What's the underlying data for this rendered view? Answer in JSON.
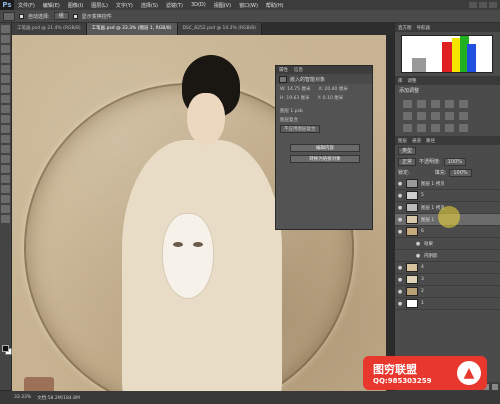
{
  "app": {
    "logo": "Ps"
  },
  "menubar": {
    "items": [
      "文件(F)",
      "编辑(E)",
      "图像(I)",
      "图层(L)",
      "文字(Y)",
      "选择(S)",
      "滤镜(T)",
      "3D(D)",
      "视图(V)",
      "窗口(W)",
      "帮助(H)"
    ]
  },
  "options": {
    "auto_select_label": "自动选择:",
    "auto_select_value": "组",
    "transform_label": "显示变换控件"
  },
  "tabs": [
    {
      "label": "工笔画.psd @ 21.4% (RGB/8)",
      "active": false
    },
    {
      "label": "工笔画.psd @ 33.3% (图层 1, RGB/8)",
      "active": true
    },
    {
      "label": "DSC_8252.psd @ 14.3% (RGB/8)",
      "active": false
    }
  ],
  "properties": {
    "tabs": [
      "属性",
      "信息"
    ],
    "type": "嵌入的智能对象",
    "w_label": "W:",
    "w_value": "14.75 厘米",
    "h_label": "H:",
    "h_value": "19.63 厘米",
    "x_label": "X:",
    "x_value": "20.40 厘米",
    "y_label": "Y:",
    "y_value": "0.10 厘米",
    "layer_name": "图层 1.psb",
    "comp_label": "图层复合",
    "comp_value": "不应用图层复合",
    "edit_btn": "编辑内容",
    "convert_btn": "转换为链接对象"
  },
  "dock": {
    "histogram_tabs": [
      "直方图",
      "导航器"
    ],
    "adjust_tabs": [
      "库",
      "调整"
    ],
    "adjust_label": "添加调整",
    "layers_tabs": [
      "图层",
      "通道",
      "路径"
    ],
    "kind": "类型",
    "blend": "正常",
    "opacity_label": "不透明度:",
    "opacity": "100%",
    "lock_label": "锁定:",
    "fill_label": "填充:",
    "fill": "100%",
    "layers": [
      {
        "name": "图层 1 拷贝",
        "thumb": "#9a9a9a",
        "selected": false
      },
      {
        "name": "5",
        "thumb": "#cfcfcf",
        "selected": false
      },
      {
        "name": "图层 1 拷贝",
        "thumb": "#bcbcbc",
        "selected": false
      },
      {
        "name": "图层 1",
        "thumb": "#d8c7a8",
        "selected": true
      },
      {
        "name": "6",
        "thumb": "#c4a97c",
        "selected": false
      },
      {
        "name": "效果",
        "thumb": "",
        "selected": false
      },
      {
        "name": "内阴影",
        "thumb": "",
        "selected": false
      },
      {
        "name": "4",
        "thumb": "#d6c29c",
        "selected": false
      },
      {
        "name": "3",
        "thumb": "#e0d2b8",
        "selected": false
      },
      {
        "name": "2",
        "thumb": "#b99f74",
        "selected": false
      },
      {
        "name": "1",
        "thumb": "#ffffff",
        "selected": false
      }
    ]
  },
  "watermark": {
    "title": "图穷联盟",
    "qq": "QQ:985303259"
  },
  "status": {
    "zoom": "33.33%",
    "doc": "文档:58.2M/184.8M"
  },
  "colors": {
    "canvas": "#c7b391",
    "badge": "#e8372c"
  }
}
